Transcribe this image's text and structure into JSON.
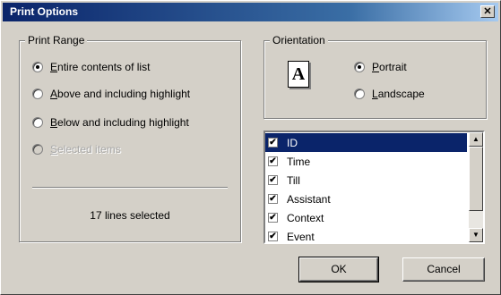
{
  "window": {
    "title": "Print Options",
    "close_glyph": "✕"
  },
  "print_range": {
    "label": "Print Range",
    "options": [
      {
        "prefix": "",
        "accel": "E",
        "rest": "ntire contents of list",
        "checked": true,
        "disabled": false
      },
      {
        "prefix": "",
        "accel": "A",
        "rest": "bove and including highlight",
        "checked": false,
        "disabled": false
      },
      {
        "prefix": "",
        "accel": "B",
        "rest": "elow and including highlight",
        "checked": false,
        "disabled": false
      },
      {
        "prefix": "",
        "accel": "S",
        "rest": "elected items",
        "checked": false,
        "disabled": true
      }
    ],
    "status": "17 lines selected"
  },
  "orientation": {
    "label": "Orientation",
    "icon_letter": "A",
    "options": [
      {
        "accel": "P",
        "rest": "ortrait",
        "checked": true
      },
      {
        "accel": "L",
        "rest": "andscape",
        "checked": false
      }
    ]
  },
  "columns": {
    "items": [
      {
        "label": "ID",
        "checked": true,
        "selected": true
      },
      {
        "label": "Time",
        "checked": true,
        "selected": false
      },
      {
        "label": "Till",
        "checked": true,
        "selected": false
      },
      {
        "label": "Assistant",
        "checked": true,
        "selected": false
      },
      {
        "label": "Context",
        "checked": true,
        "selected": false
      },
      {
        "label": "Event",
        "checked": true,
        "selected": false
      }
    ],
    "check_glyph": "✔",
    "scroll_up_glyph": "▲",
    "scroll_down_glyph": "▼"
  },
  "buttons": {
    "ok_label": "OK",
    "cancel_label": "Cancel"
  }
}
